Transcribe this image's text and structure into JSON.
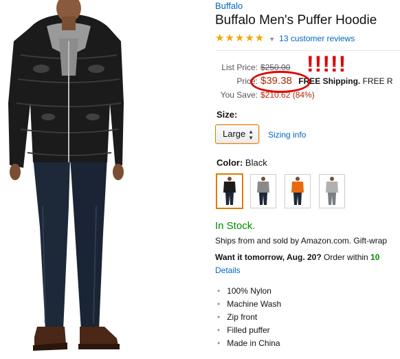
{
  "product": {
    "brand": "Buffalo",
    "title": "Buffalo Men's Puffer Hoodie",
    "stars": "★★★★★",
    "rating": 5,
    "review_link": "13 customer reviews"
  },
  "pricing": {
    "list_price_label": "List Price:",
    "list_price": "$250.00",
    "price_label": "Price:",
    "price": "$39.38",
    "free_shipping_prefix": "FREE Shipping.",
    "free_shipping_suffix": "FREE R",
    "you_save_label": "You Save:",
    "you_save": "$210.62 (84%)",
    "annotation": "!!!!!"
  },
  "size": {
    "label": "Size:",
    "selected": "Large",
    "sizing_link": "Sizing info"
  },
  "color": {
    "label": "Color:",
    "selected": "Black",
    "swatches": [
      "Black",
      "Grey",
      "Orange",
      "Light Grey"
    ]
  },
  "availability": {
    "status": "In Stock.",
    "ships": "Ships from and sold by Amazon.com. Gift-wrap",
    "want_prefix": "Want it tomorrow, Aug. 20?",
    "order_within": "Order within",
    "countdown": "10",
    "details_link": "Details"
  },
  "features": [
    "100% Nylon",
    "Machine Wash",
    "Zip front",
    "Filled puffer",
    "Made in China"
  ],
  "colors": {
    "price_red": "#b12704",
    "link_blue": "#0066c0",
    "stock_green": "#008a00",
    "annotation_red": "#e00000",
    "star_gold": "#f0a800"
  }
}
